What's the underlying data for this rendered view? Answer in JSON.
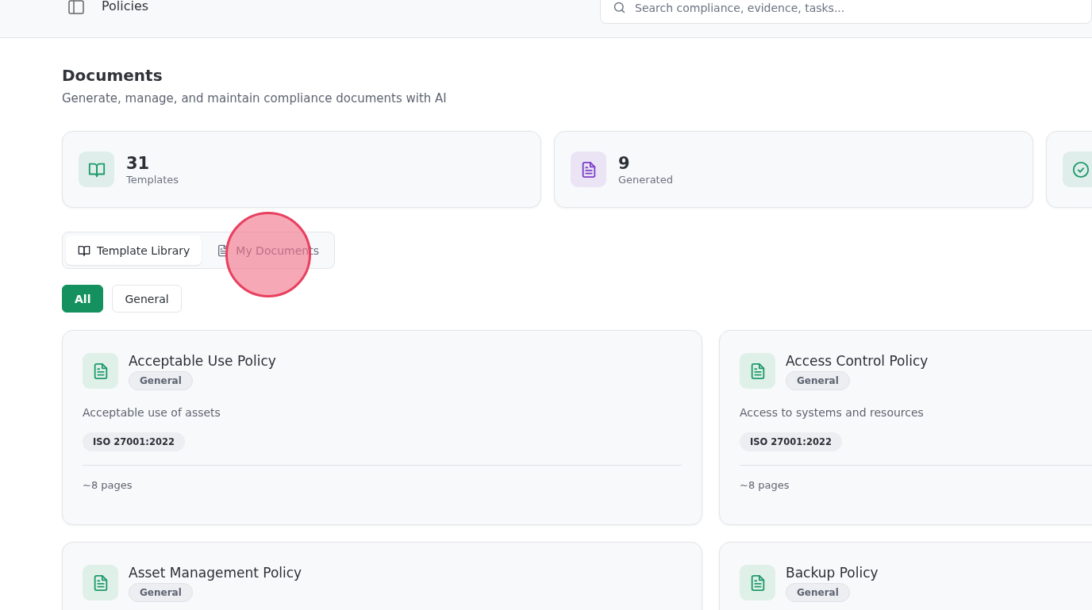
{
  "topbar": {
    "title": "Policies",
    "search": {
      "placeholder": "Search compliance, evidence, tasks..."
    }
  },
  "header": {
    "title": "Documents",
    "subtitle": "Generate, manage, and maintain compliance documents with AI"
  },
  "stats": [
    {
      "kind": "book",
      "color": "#1f9a6a",
      "value": "31",
      "label": "Templates"
    },
    {
      "kind": "document",
      "color": "#7e3fc8",
      "value": "9",
      "label": "Generated"
    },
    {
      "kind": "check",
      "color": "#1f9a6a"
    }
  ],
  "tabs": [
    {
      "kind": "book",
      "label": "Template Library",
      "selected": true,
      "clicked": false
    },
    {
      "kind": "document",
      "label": "My Documents",
      "selected": false,
      "clicked": true
    }
  ],
  "filters": [
    {
      "label": "All",
      "selected": true
    },
    {
      "label": "General",
      "selected": false
    }
  ],
  "templates": [
    {
      "title": "Acceptable Use Policy",
      "category": "General",
      "description": "Acceptable use of assets",
      "standard": "ISO 27001:2022",
      "pages": "~8 pages"
    },
    {
      "title": "Access Control Policy",
      "category": "General",
      "description": "Access to systems and resources",
      "standard": "ISO 27001:2022",
      "pages": "~8 pages"
    },
    {
      "title": "Asset Management Policy",
      "category": "General"
    },
    {
      "title": "Backup Policy",
      "category": "General"
    }
  ]
}
